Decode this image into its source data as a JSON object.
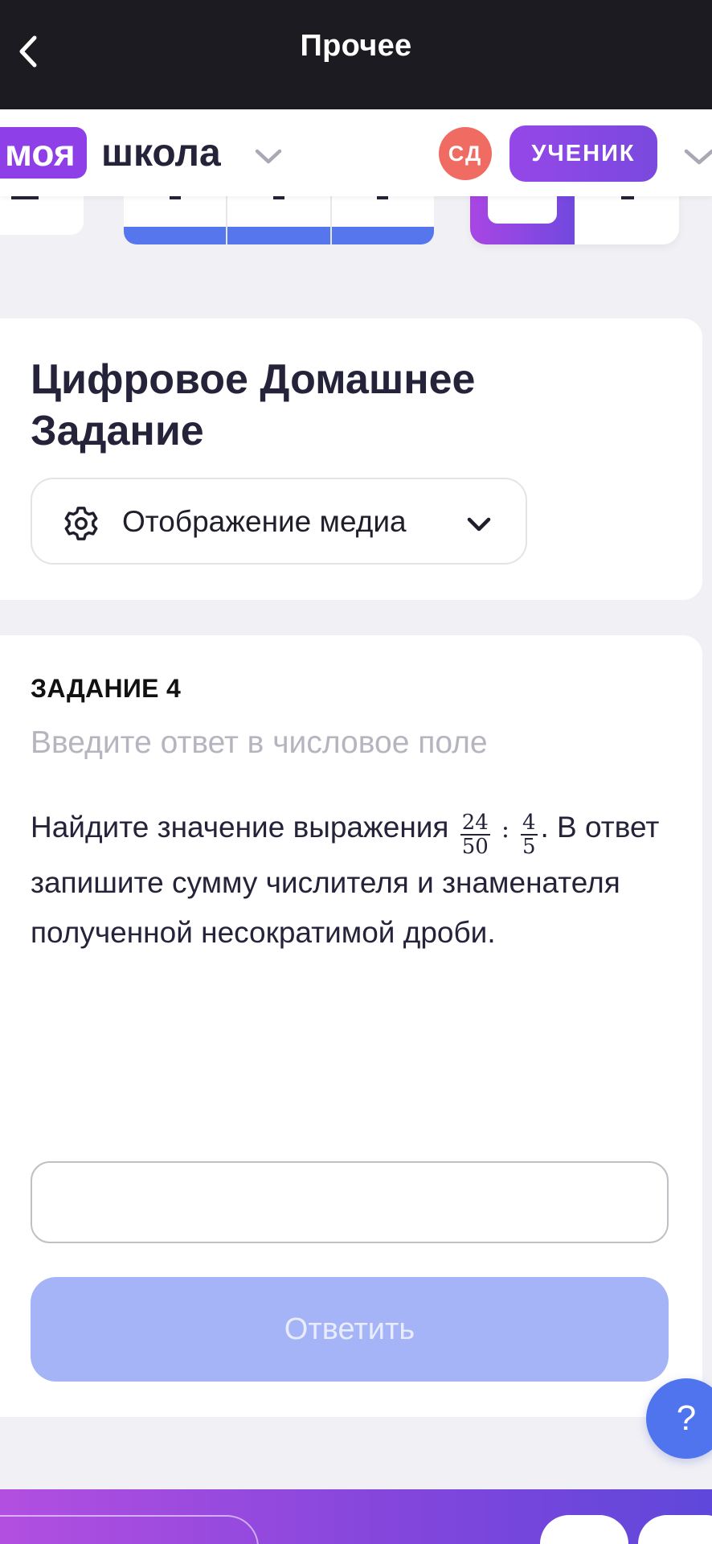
{
  "navbar": {
    "title": "Прочее",
    "back_icon": "chevron-left-icon"
  },
  "brand": {
    "logo_part1": "моя",
    "logo_part2": "школа",
    "avatar_initials": "СД",
    "role": "УЧЕНИК"
  },
  "homework_card": {
    "title": "Цифровое Домашнее Задание",
    "media_select_label": "Отображение медиа",
    "media_icon": "gear-icon"
  },
  "task": {
    "number_label": "ЗАДАНИЕ 4",
    "hint": "Введите ответ в числовое поле",
    "text_before": "Найдите значение выражения",
    "fraction1": {
      "numerator": "24",
      "denominator": "50"
    },
    "operator": ":",
    "fraction2": {
      "numerator": "4",
      "denominator": "5"
    },
    "text_after": ". В ответ запишите сумму числителя и знаменателя полученной несократимой дроби.",
    "answer_value": "",
    "submit_label": "Ответить"
  },
  "help": {
    "label": "?"
  },
  "colors": {
    "brand_purple": "#8e3fe7",
    "accent_blue": "#5676ee",
    "submit_disabled": "#a4b4f6",
    "avatar_red": "#f06b62",
    "navbar_bg": "#1c1b21"
  }
}
